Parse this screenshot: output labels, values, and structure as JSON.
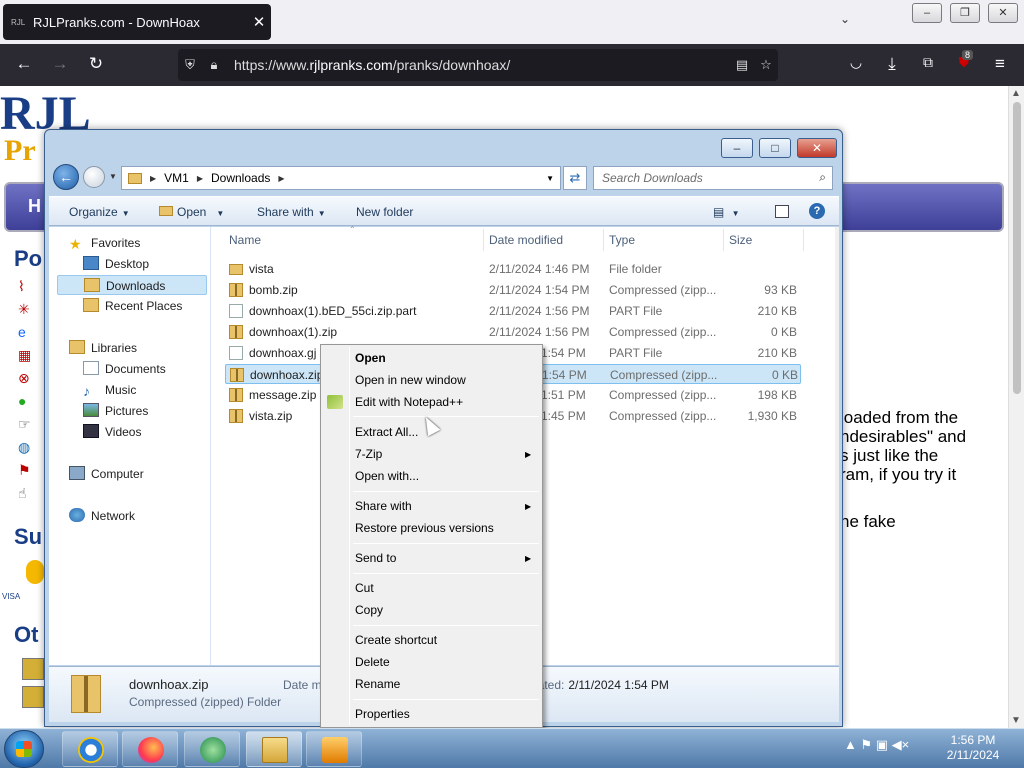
{
  "browser": {
    "tab_title": "RJLPranks.com - DownHoax",
    "tab_favicon_text": "RJL",
    "close_tab_glyph": "✕",
    "new_tab_glyph": "+",
    "list_tabs_glyph": "⌄",
    "window_minimize": "–",
    "window_restore": "❐",
    "window_close": "✕",
    "url_prefix": "https://www.",
    "url_domain": "rjlpranks.com",
    "url_path": "/pranks/downhoax/",
    "back_glyph": "←",
    "forward_glyph": "→",
    "reload_glyph": "↻",
    "extension_badge_count": "8"
  },
  "webpage": {
    "logo_text": "RJL",
    "logo_sub": "Pr",
    "nav_label": "H",
    "side_heading_1": "Po",
    "side_heading_2": "Su",
    "side_heading_3": "Ot",
    "pay_tag": "VISA",
    "text_lines": [
      "loaded from the",
      "ndesirables\" and",
      "s just like the",
      "ram, if you try it",
      "",
      "ne fake"
    ]
  },
  "explorer": {
    "address_segments": [
      "VM1",
      "Downloads"
    ],
    "search_placeholder": "Search Downloads",
    "toolbar": {
      "organize": "Organize",
      "open": "Open",
      "share_with": "Share with",
      "new_folder": "New folder",
      "help": "?"
    },
    "nav": {
      "favorites": "Favorites",
      "desktop": "Desktop",
      "downloads": "Downloads",
      "recent_places": "Recent Places",
      "libraries": "Libraries",
      "documents": "Documents",
      "music": "Music",
      "pictures": "Pictures",
      "videos": "Videos",
      "computer": "Computer",
      "network": "Network"
    },
    "columns": {
      "name": "Name",
      "date_modified": "Date modified",
      "type": "Type",
      "size": "Size"
    },
    "files": [
      {
        "name": "vista",
        "date": "2/11/2024 1:46 PM",
        "type": "File folder",
        "size": "",
        "icon": "folder-icon"
      },
      {
        "name": "bomb.zip",
        "date": "2/11/2024 1:54 PM",
        "type": "Compressed (zipp...",
        "size": "93 KB",
        "icon": "zip-icon"
      },
      {
        "name": "downhoax(1).bED_55ci.zip.part",
        "date": "2/11/2024 1:56 PM",
        "type": "PART File",
        "size": "210 KB",
        "icon": "file-icon"
      },
      {
        "name": "downhoax(1).zip",
        "date": "2/11/2024 1:56 PM",
        "type": "Compressed (zipp...",
        "size": "0 KB",
        "icon": "zip-icon"
      },
      {
        "name": "downhoax.gj",
        "date": "1:54 PM",
        "type": "PART File",
        "size": "210 KB",
        "icon": "file-icon"
      },
      {
        "name": "downhoax.zip",
        "date": "1:54 PM",
        "type": "Compressed (zipp...",
        "size": "0 KB",
        "icon": "zip-icon"
      },
      {
        "name": "message.zip",
        "date": "1:51 PM",
        "type": "Compressed (zipp...",
        "size": "198 KB",
        "icon": "zip-icon"
      },
      {
        "name": "vista.zip",
        "date": "1:45 PM",
        "type": "Compressed (zipp...",
        "size": "1,930 KB",
        "icon": "zip-icon"
      }
    ],
    "selected_index": 5,
    "details": {
      "name": "downhoax.zip",
      "type": "Compressed (zipped) Folder",
      "date_modified_label": "Date m",
      "created_label": "eated:",
      "created_value": "2/11/2024 1:54 PM"
    }
  },
  "context_menu": {
    "items": [
      {
        "label": "Open",
        "bold": true,
        "submenu": false
      },
      {
        "label": "Open in new window",
        "submenu": false
      },
      {
        "label": "Edit with Notepad++",
        "submenu": false
      },
      {
        "label": "Extract All...",
        "submenu": false
      },
      {
        "label": "7-Zip",
        "submenu": true
      },
      {
        "label": "Open with...",
        "submenu": false
      },
      {
        "label": "Share with",
        "submenu": true
      },
      {
        "label": "Restore previous versions",
        "submenu": false
      },
      {
        "label": "Send to",
        "submenu": true
      },
      {
        "label": "Cut",
        "submenu": false
      },
      {
        "label": "Copy",
        "submenu": false
      },
      {
        "label": "Create shortcut",
        "submenu": false
      },
      {
        "label": "Delete",
        "submenu": false
      },
      {
        "label": "Rename",
        "submenu": false
      },
      {
        "label": "Properties",
        "submenu": false
      }
    ],
    "submenu_glyph": "▶"
  },
  "taskbar": {
    "time": "1:56 PM",
    "date": "2/11/2024",
    "tray_glyphs": "▲ ⚑ ▣ ◀×"
  }
}
